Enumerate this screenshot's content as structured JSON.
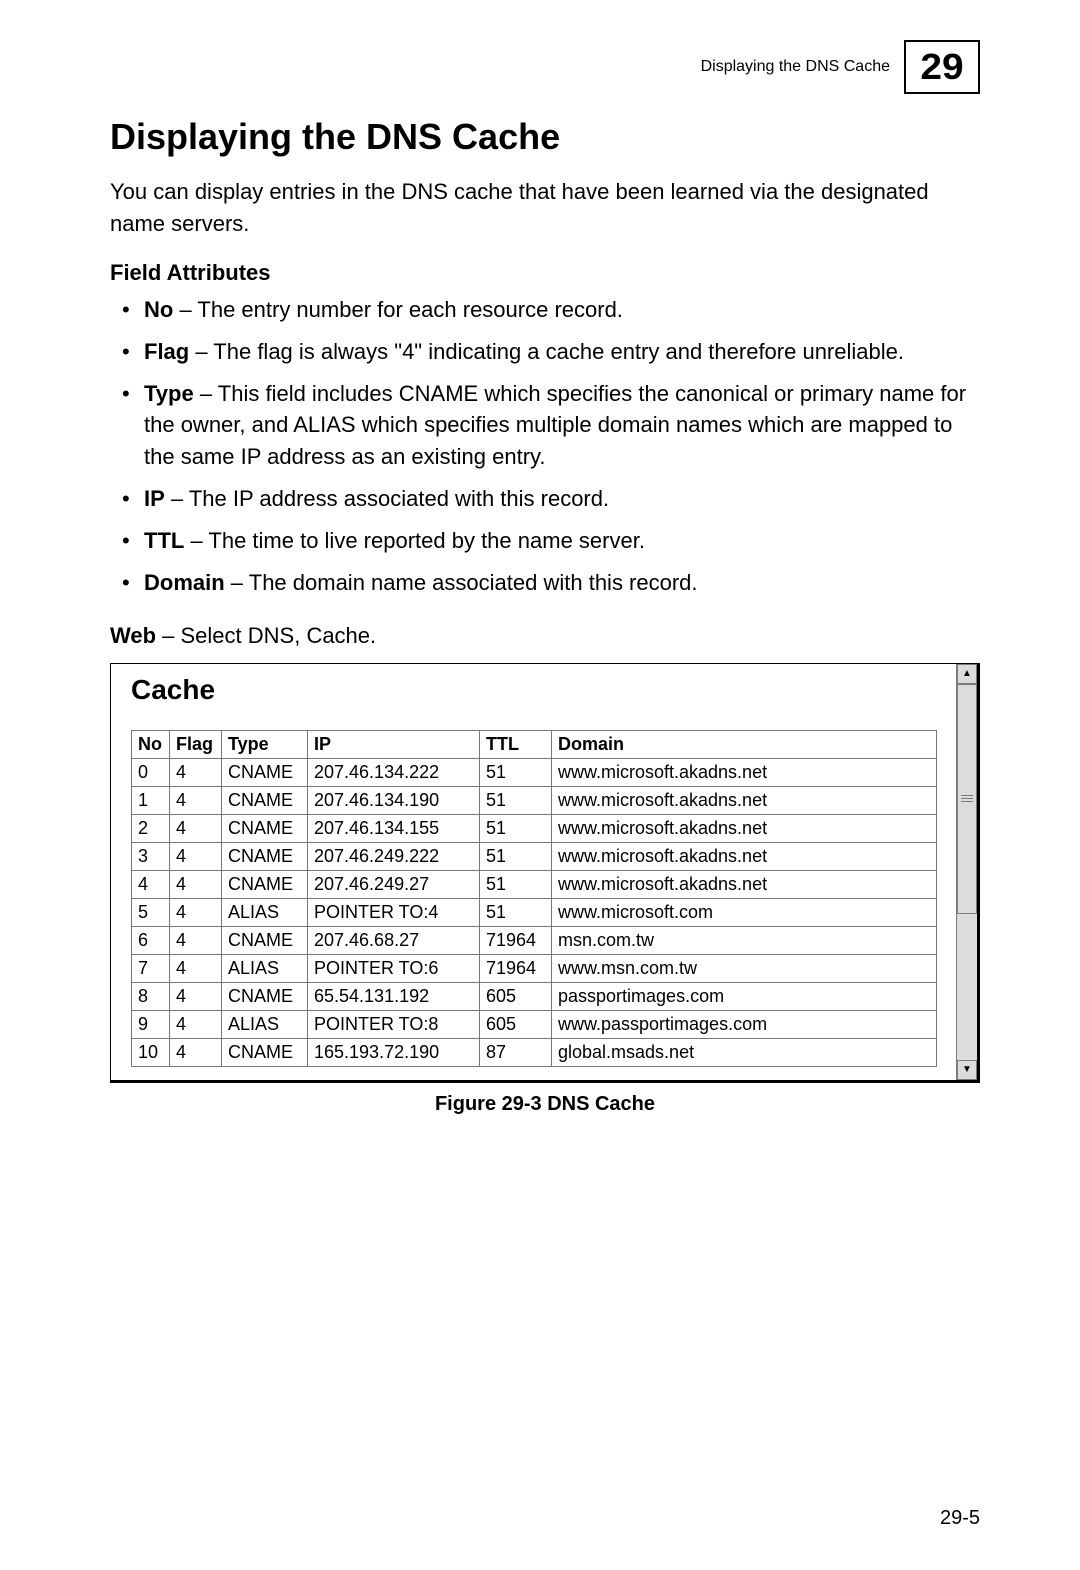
{
  "header": {
    "running_title": "Displaying the DNS Cache",
    "chapter_number": "29"
  },
  "title": "Displaying the DNS Cache",
  "intro": "You can display entries in the DNS cache that have been learned via the designated name servers.",
  "field_attributes_heading": "Field Attributes",
  "attributes": [
    {
      "name": "No",
      "desc": "The entry number for each resource record."
    },
    {
      "name": "Flag",
      "desc": "The flag is always \"4\" indicating a cache entry and therefore unreliable."
    },
    {
      "name": "Type",
      "desc": "This field includes CNAME which specifies the canonical or primary name for the owner, and ALIAS which specifies multiple domain names which are mapped to the same IP address as an existing entry."
    },
    {
      "name": "IP",
      "desc": "The IP address associated with this record."
    },
    {
      "name": "TTL",
      "desc": "The time to live reported by the name server."
    },
    {
      "name": "Domain",
      "desc": "The domain name associated with this record."
    }
  ],
  "web_label": "Web",
  "web_text": " – Select DNS, Cache.",
  "panel": {
    "title": "Cache",
    "columns": [
      "No",
      "Flag",
      "Type",
      "IP",
      "TTL",
      "Domain"
    ],
    "rows": [
      {
        "no": "0",
        "flag": "4",
        "type": "CNAME",
        "ip": "207.46.134.222",
        "ttl": "51",
        "domain": "www.microsoft.akadns.net"
      },
      {
        "no": "1",
        "flag": "4",
        "type": "CNAME",
        "ip": "207.46.134.190",
        "ttl": "51",
        "domain": "www.microsoft.akadns.net"
      },
      {
        "no": "2",
        "flag": "4",
        "type": "CNAME",
        "ip": "207.46.134.155",
        "ttl": "51",
        "domain": "www.microsoft.akadns.net"
      },
      {
        "no": "3",
        "flag": "4",
        "type": "CNAME",
        "ip": "207.46.249.222",
        "ttl": "51",
        "domain": "www.microsoft.akadns.net"
      },
      {
        "no": "4",
        "flag": "4",
        "type": "CNAME",
        "ip": "207.46.249.27",
        "ttl": "51",
        "domain": "www.microsoft.akadns.net"
      },
      {
        "no": "5",
        "flag": "4",
        "type": "ALIAS",
        "ip": "POINTER TO:4",
        "ttl": "51",
        "domain": "www.microsoft.com"
      },
      {
        "no": "6",
        "flag": "4",
        "type": "CNAME",
        "ip": "207.46.68.27",
        "ttl": "71964",
        "domain": "msn.com.tw"
      },
      {
        "no": "7",
        "flag": "4",
        "type": "ALIAS",
        "ip": "POINTER TO:6",
        "ttl": "71964",
        "domain": "www.msn.com.tw"
      },
      {
        "no": "8",
        "flag": "4",
        "type": "CNAME",
        "ip": "65.54.131.192",
        "ttl": "605",
        "domain": "passportimages.com"
      },
      {
        "no": "9",
        "flag": "4",
        "type": "ALIAS",
        "ip": "POINTER TO:8",
        "ttl": "605",
        "domain": "www.passportimages.com"
      },
      {
        "no": "10",
        "flag": "4",
        "type": "CNAME",
        "ip": "165.193.72.190",
        "ttl": "87",
        "domain": "global.msads.net"
      }
    ]
  },
  "figure_caption": "Figure 29-3  DNS Cache",
  "page_number": "29-5",
  "glyphs": {
    "up": "▲",
    "down": "▼"
  }
}
